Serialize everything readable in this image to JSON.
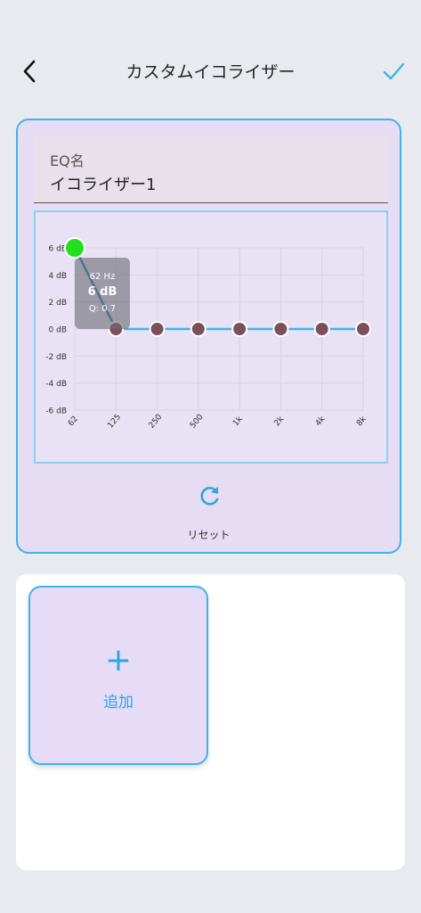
{
  "header": {
    "title": "カスタムイコライザー",
    "back_icon": "chevron-left-icon",
    "confirm_icon": "check-icon",
    "accent_color": "#3fb4ea"
  },
  "eq_name": {
    "label": "EQ名",
    "value": "イコライザー1"
  },
  "reset": {
    "label": "リセット",
    "icon": "refresh-icon"
  },
  "add_button": {
    "plus": "+",
    "label": "追加"
  },
  "chart_data": {
    "type": "line",
    "x": [
      "62",
      "125",
      "250",
      "500",
      "1k",
      "2k",
      "4k",
      "8k"
    ],
    "y_ticks": [
      "6 dB",
      "4 dB",
      "2 dB",
      "0 dB",
      "-2 dB",
      "-4 dB",
      "-6 dB"
    ],
    "ylim": [
      -6,
      6
    ],
    "grid": true,
    "series": [
      {
        "values": [
          6,
          0,
          0,
          0,
          0,
          0,
          0,
          0
        ]
      }
    ],
    "selected_index": 0,
    "tooltip": {
      "freq": "62 Hz",
      "gain": "6 dB",
      "q": "Q: 0.7"
    },
    "line_color": "#3fb4ea",
    "point_color": "#7b4f5c",
    "selected_color": "#22e01e"
  }
}
